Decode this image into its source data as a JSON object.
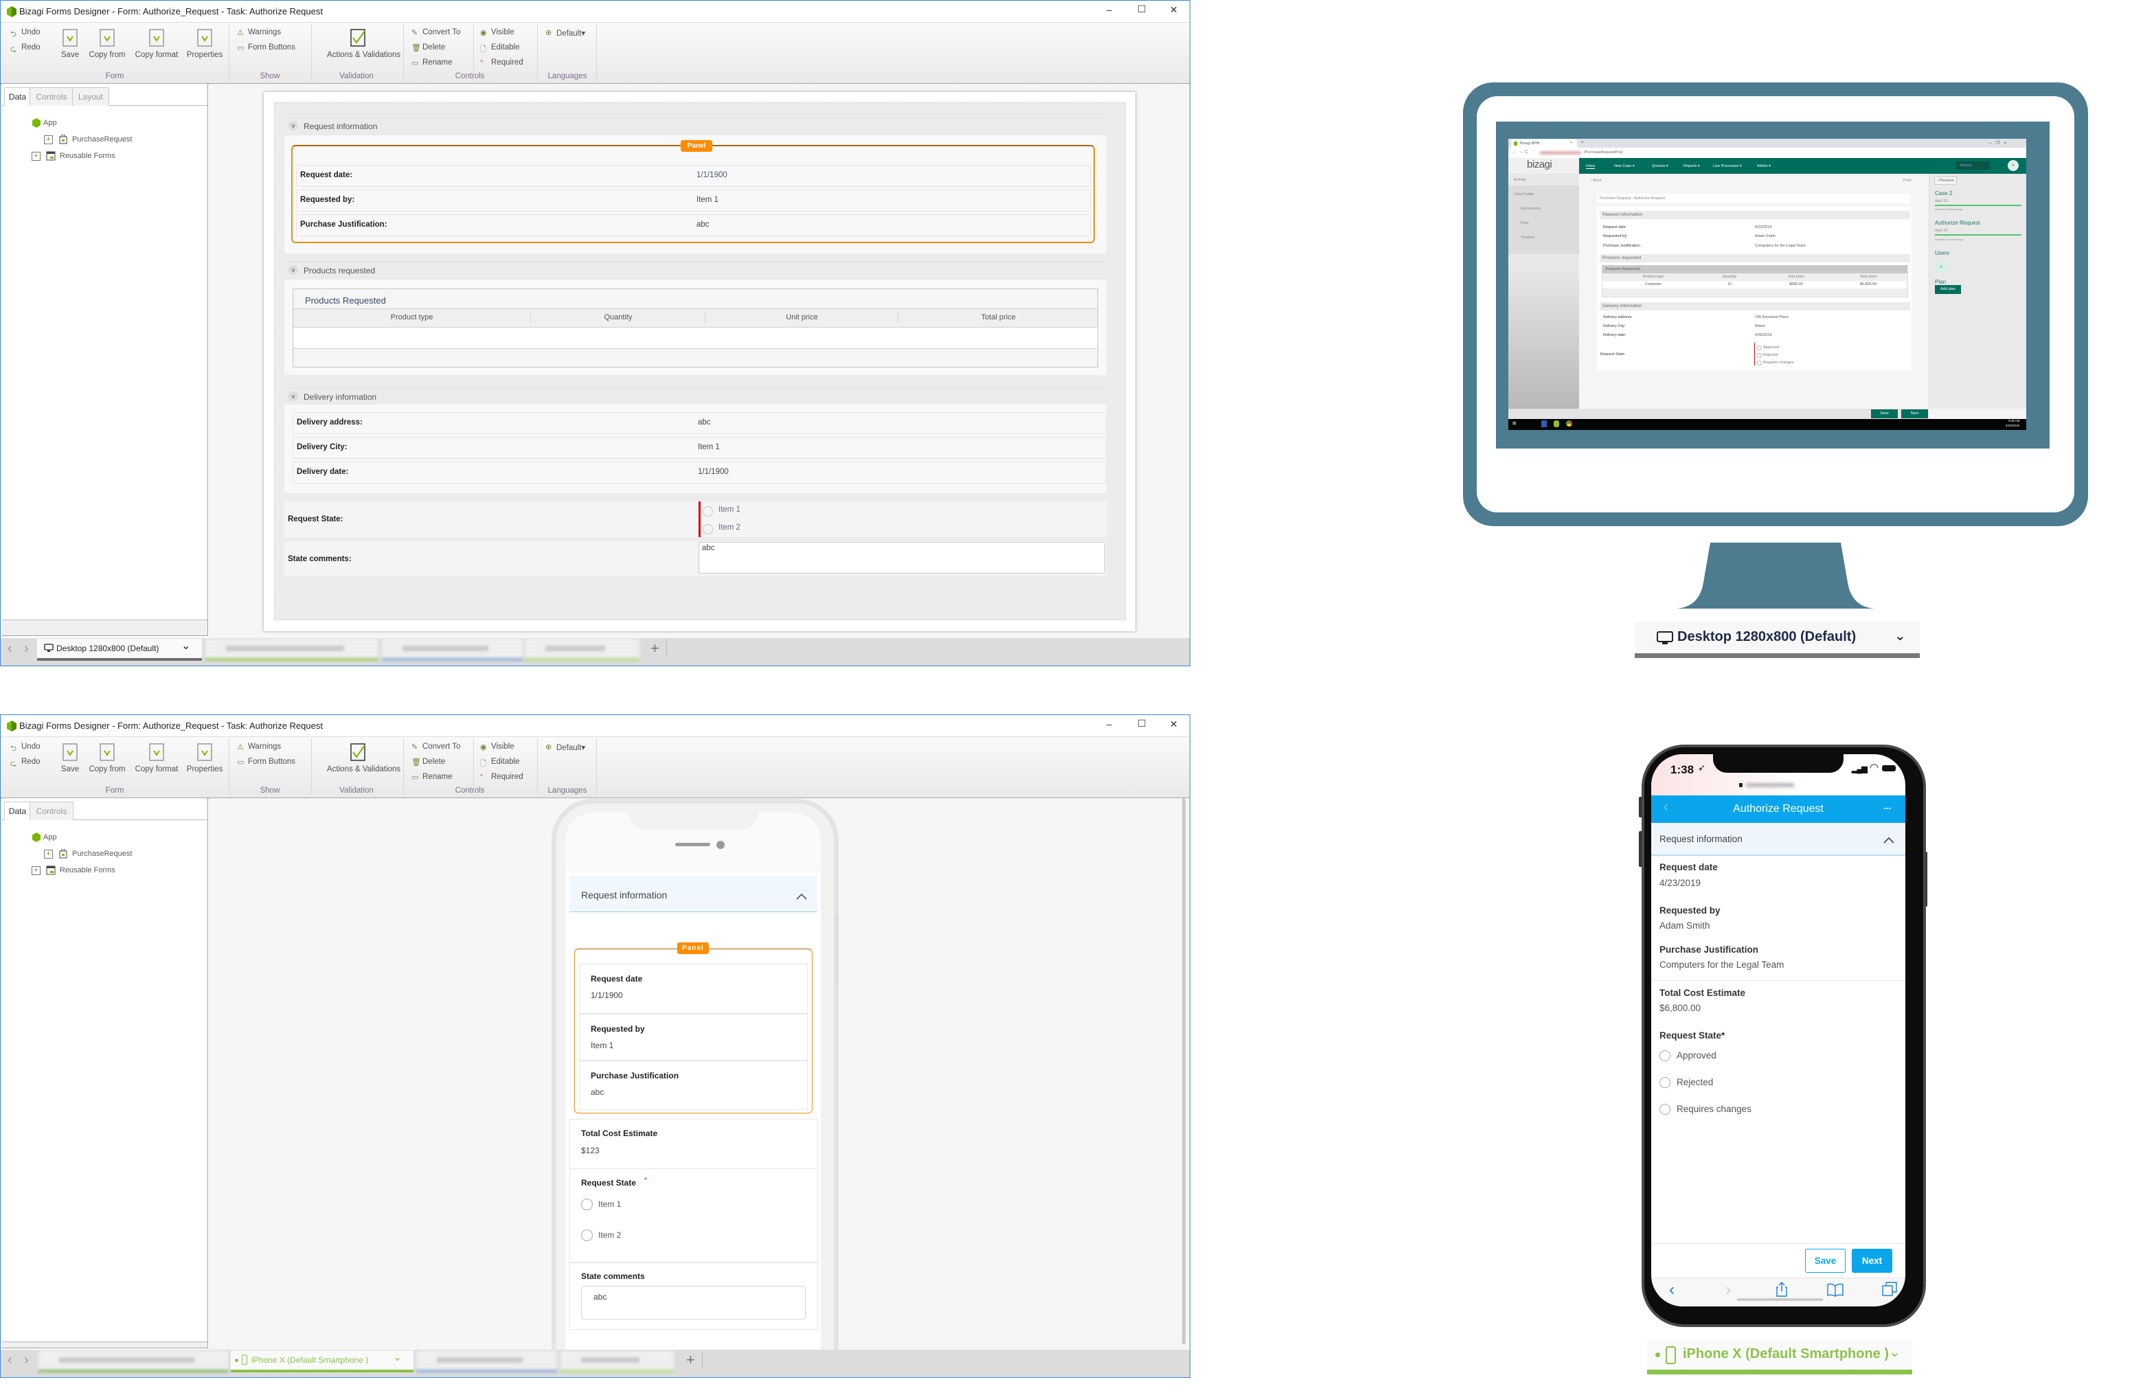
{
  "app_title": "Bizagi Forms Designer  - Form: Authorize_Request - Task:  Authorize Request",
  "window_controls": {
    "minimize": "–",
    "maximize": "☐",
    "close": "✕"
  },
  "ribbon": {
    "undo": "Undo",
    "redo": "Redo",
    "save": "Save",
    "copy_from": "Copy from",
    "copy_format": "Copy format",
    "properties": "Properties",
    "group_form": "Form",
    "warnings": "Warnings",
    "form_buttons": "Form Buttons",
    "group_show": "Show",
    "actions_validations": "Actions & Validations",
    "group_validation": "Validation",
    "convert_to": "Convert To",
    "delete": "Delete",
    "rename": "Rename",
    "visible": "Visible",
    "editable": "Editable",
    "required": "Required",
    "group_controls": "Controls",
    "language": "Default▾",
    "group_languages": "Languages"
  },
  "left_panel": {
    "tabs_desktop": [
      "Data",
      "Controls",
      "Layout"
    ],
    "tabs_mobile": [
      "Data",
      "Controls"
    ],
    "tree": {
      "root": "App",
      "children": [
        "PurchaseRequest",
        "Reusable Forms"
      ]
    }
  },
  "desktop_form": {
    "request_info": {
      "title": "Request information",
      "panel_badge": "Panel",
      "fields": [
        {
          "label": "Request date:",
          "value": "1/1/1900"
        },
        {
          "label": "Requested by:",
          "value": "Item 1"
        },
        {
          "label": "Purchase Justification:",
          "value": "abc"
        }
      ]
    },
    "products": {
      "title": "Products requested",
      "grid_title": "Products Requested",
      "columns": [
        "Product type",
        "Quantity",
        "Unit price",
        "Total price"
      ]
    },
    "delivery": {
      "title": "Delivery information",
      "fields": [
        {
          "label": "Delivery address:",
          "value": "abc"
        },
        {
          "label": "Delivery City:",
          "value": "Item 1"
        },
        {
          "label": "Delivery date:",
          "value": "1/1/1900"
        }
      ]
    },
    "request_state": {
      "label": "Request State:",
      "options": [
        "Item 1",
        "Item 2"
      ]
    },
    "state_comments": {
      "label": "State comments:",
      "value": "abc"
    }
  },
  "mobile_form": {
    "header": "Request information",
    "panel_badge": "Panel",
    "fields": [
      {
        "label": "Request date",
        "value": "1/1/1900"
      },
      {
        "label": "Requested by",
        "value": "Item 1"
      },
      {
        "label": "Purchase Justification",
        "value": "abc"
      }
    ],
    "total": {
      "label": "Total Cost Estimate",
      "value": "$123"
    },
    "request_state": {
      "label": "Request State",
      "required_mark": "*",
      "options": [
        "Item 1",
        "Item 2"
      ]
    },
    "state_comments": {
      "label": "State comments",
      "value": "abc"
    }
  },
  "device_tabs": {
    "desktop": "Desktop 1280x800 (Default)",
    "iphone": "iPhone X (Default Smartphone )",
    "add": "+",
    "prev": "‹",
    "next": "›",
    "chevron": "⌄"
  },
  "preview_desktop": {
    "label": "Desktop 1280x800 (Default)",
    "browser_tab": "Bizagi BPM",
    "url": "/PurchaseRequestProj/",
    "logo": "bizagi",
    "nav": [
      "Inbox",
      "New Case ▾",
      "Queries ▾",
      "Reports ▾",
      "Live Processes ▾",
      "Admin ▾"
    ],
    "search": "Search",
    "avatar": "A",
    "sidebar": [
      "Activity",
      "Case Folder",
      "Discussions",
      "Files",
      "Timeline"
    ],
    "back": "‹ Back",
    "print": "Print",
    "breadcrumb": "Purchase Request › Authorize Request",
    "request_info": {
      "title": "Request information",
      "fields": [
        {
          "label": "Request date:",
          "value": "4/23/2019"
        },
        {
          "label": "Requested by:",
          "value": "Adam Smith"
        },
        {
          "label": "Purchase Justification:",
          "value": "Computers for the Legal Team"
        }
      ]
    },
    "products": {
      "title": "Products requested",
      "grid_title": "Products Requested",
      "columns": [
        "Product type",
        "Quantity",
        "Unit price",
        "Total price"
      ],
      "rows": [
        [
          "Computer",
          "10",
          "$680.00",
          "$6,800.00"
        ]
      ]
    },
    "delivery": {
      "title": "Delivery information",
      "fields": [
        {
          "label": "Delivery address:",
          "value": "145 Kenwood Place"
        },
        {
          "label": "Delivery City:",
          "value": "Miami"
        },
        {
          "label": "Delivery date:",
          "value": "4/30/2019"
        }
      ]
    },
    "request_state": {
      "label": "Request State:",
      "options": [
        "Approved",
        "Rejected",
        "Requires changes"
      ]
    },
    "right_panel": {
      "previous": "‹ Previous",
      "case": "Case 2",
      "case_date": "April 23",
      "case_created": "Created 6 minutes ago",
      "task": "Authorize Request",
      "task_date": "April 23",
      "task_created": "Created a moment ago",
      "users": "Users",
      "user_avatar": "A",
      "plan": "Plan",
      "add_plan": "Add plan"
    },
    "save": "Save",
    "next": "Next",
    "clock_time": "9:48 AM",
    "clock_date": "4/23/2019"
  },
  "preview_mobile": {
    "label": "iPhone X (Default Smartphone )",
    "time": "1:38",
    "title": "Authorize Request",
    "more": "...",
    "section": "Request information",
    "fields": [
      {
        "label": "Request date",
        "value": "4/23/2019"
      },
      {
        "label": "Requested by",
        "value": "Adam Smith"
      },
      {
        "label": "Purchase Justification",
        "value": "Computers for the Legal Team"
      },
      {
        "label": "Total Cost Estimate",
        "value": "$6,800.00"
      }
    ],
    "request_state": "Request State*",
    "options": [
      "Approved",
      "Rejected",
      "Requires changes"
    ],
    "save": "Save",
    "next": "Next"
  },
  "colors": {
    "panel_orange": "#ff8c00",
    "bizagi_green": "#006e5c",
    "mobile_blue": "#0ba5ec",
    "smartphone_green": "#8bc34a",
    "monitor_teal": "#4d7b90",
    "required_red": "#e00000"
  }
}
